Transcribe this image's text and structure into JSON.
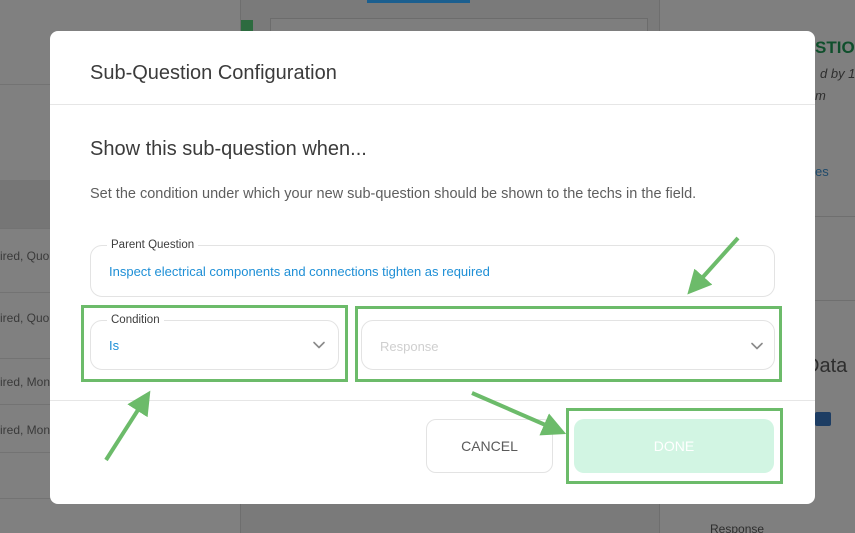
{
  "background": {
    "left_rows": [
      "ired, Quo",
      "ired, Quo",
      "ired, Mon",
      "ired, Mon"
    ],
    "right": {
      "heading": "STIO",
      "subtitle": "d by 1:",
      "subtitle2": "m",
      "link": "es",
      "big_heading": "Data",
      "bottom_label": "Response"
    }
  },
  "modal": {
    "title": "Sub-Question Configuration",
    "section_title": "Show this sub-question when...",
    "description": "Set the condition under which your new sub-question should be shown to the techs in the field.",
    "parent_question": {
      "label": "Parent Question",
      "value": "Inspect electrical components and connections tighten as required"
    },
    "condition": {
      "label": "Condition",
      "value": "Is"
    },
    "response": {
      "placeholder": "Response"
    },
    "buttons": {
      "cancel": "CANCEL",
      "done": "DONE"
    }
  },
  "colors": {
    "accent_blue": "#1e8fd6",
    "done_bg": "#d2f5e3",
    "annotation_green": "#6cbb6a"
  },
  "icons": [
    "chevron-down-icon",
    "briefcase-icon"
  ]
}
